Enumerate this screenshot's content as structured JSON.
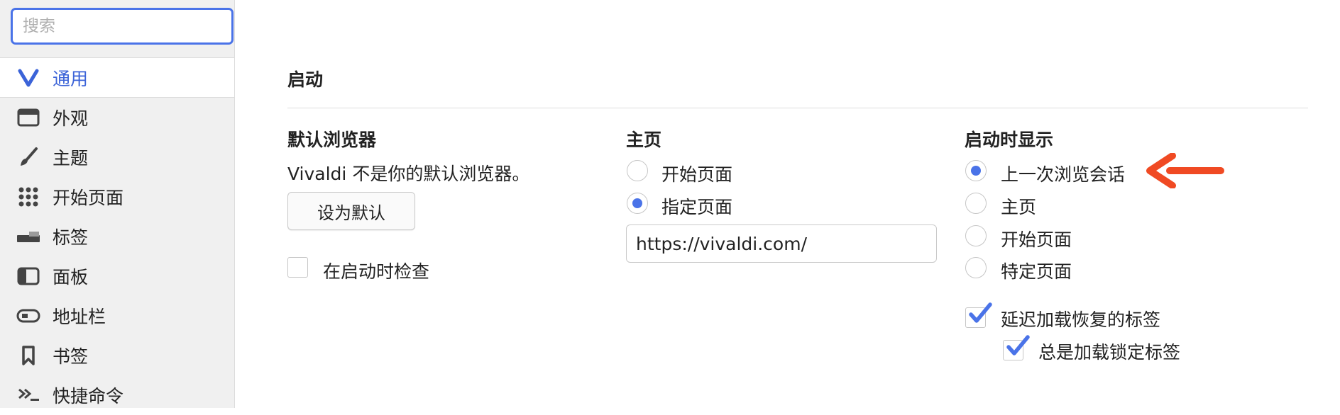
{
  "search": {
    "placeholder": "搜索"
  },
  "sidebar": {
    "items": [
      {
        "label": "通用",
        "icon": "vivaldi-logo-icon",
        "active": true
      },
      {
        "label": "外观",
        "icon": "window-icon"
      },
      {
        "label": "主题",
        "icon": "brush-icon"
      },
      {
        "label": "开始页面",
        "icon": "grid-icon"
      },
      {
        "label": "标签",
        "icon": "tabs-icon"
      },
      {
        "label": "面板",
        "icon": "panel-icon"
      },
      {
        "label": "地址栏",
        "icon": "address-bar-icon"
      },
      {
        "label": "书签",
        "icon": "bookmark-icon"
      },
      {
        "label": "快捷命令",
        "icon": "quick-commands-icon"
      }
    ]
  },
  "main": {
    "section_title": "启动",
    "default_browser": {
      "heading": "默认浏览器",
      "status": "Vivaldi 不是你的默认浏览器。",
      "button": "设为默认",
      "check_on_startup": {
        "label": "在启动时检查",
        "checked": false
      }
    },
    "homepage": {
      "heading": "主页",
      "options": [
        {
          "label": "开始页面",
          "checked": false
        },
        {
          "label": "指定页面",
          "checked": true
        }
      ],
      "url": "https://vivaldi.com/"
    },
    "startup": {
      "heading": "启动时显示",
      "options": [
        {
          "label": "上一次浏览会话",
          "checked": true
        },
        {
          "label": "主页",
          "checked": false
        },
        {
          "label": "开始页面",
          "checked": false
        },
        {
          "label": "特定页面",
          "checked": false
        }
      ],
      "lazy_load": {
        "label": "延迟加载恢复的标签",
        "checked": true
      },
      "lazy_load_pinned": {
        "label": "总是加载锁定标签",
        "checked": true
      }
    }
  },
  "colors": {
    "accent": "#4a73e8",
    "annotation_arrow": "#f04a23"
  }
}
